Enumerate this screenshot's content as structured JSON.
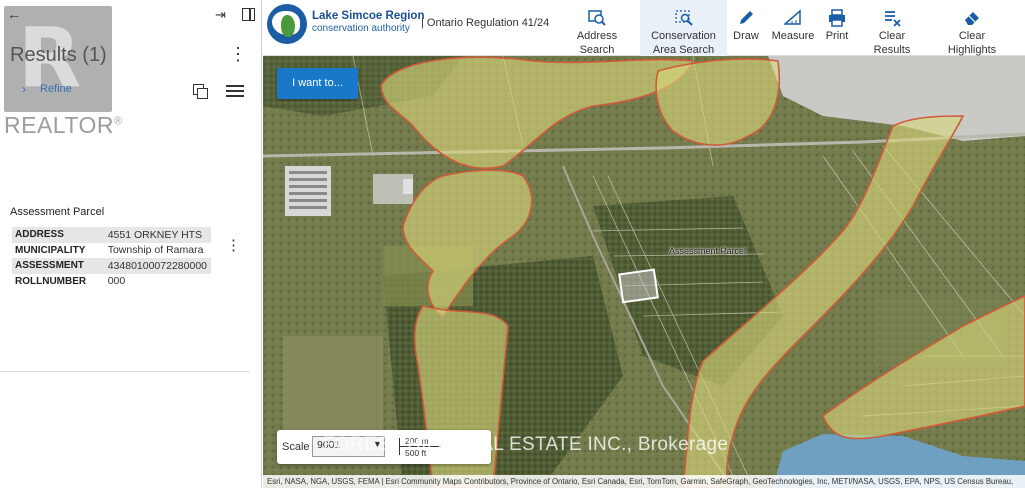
{
  "left_panel": {
    "results_title": "Results (1)",
    "refine_label": "Refine",
    "more_glyph": "⋮",
    "back_glyph": "←",
    "parcel_heading": "Assessment Parcel",
    "attributes": [
      {
        "key": "ADDRESS",
        "value": "4551 ORKNEY HTS"
      },
      {
        "key": "MUNICIPALITY",
        "value": "Township of Ramara"
      },
      {
        "key": "ASSESSMENT",
        "value": "43480100072280000"
      },
      {
        "key": "ROLLNUMBER",
        "value": "000"
      }
    ]
  },
  "watermark": {
    "logo_letter": "R",
    "word": "REALTOR",
    "registered": "®"
  },
  "header": {
    "org_name_line1": "Lake Simcoe Region",
    "org_name_line2": "conservation authority",
    "regulation": "| Ontario Regulation 41/24",
    "tools": [
      {
        "label": "Address Search",
        "icon": "address-search-icon"
      },
      {
        "label": "Conservation Area Search",
        "icon": "area-search-icon"
      },
      {
        "label": "Draw",
        "icon": "pencil-icon"
      },
      {
        "label": "Measure",
        "icon": "ruler-icon"
      },
      {
        "label": "Print",
        "icon": "printer-icon"
      },
      {
        "label": "Clear Results",
        "icon": "clear-results-icon"
      },
      {
        "label": "Clear Highlights",
        "icon": "eraser-icon"
      }
    ],
    "accent_color": "#1b5ea6"
  },
  "map": {
    "i_want_to_label": "I want to...",
    "parcel_label": "Assessment Parcel",
    "scale_label": "Scale",
    "scale_value": "9001",
    "scale_bar_top": "200 m",
    "scale_bar_bottom": "500 ft",
    "brokerage_watermark": "FOREST HILL REAL ESTATE INC., Brokerage",
    "attribution": "Esri, NASA, NGA, USGS, FEMA | Esri Community Maps Contributors, Province of Ontario, Esri Canada, Esri, TomTom, Garmin, SafeGraph, GeoTechnologies, Inc, METI/NASA, USGS, EPA, NPS, US Census Bureau,",
    "colors": {
      "regulated_fill": "#d8d67a",
      "regulated_outline": "#d05a3a",
      "button": "#1a78c8"
    }
  }
}
